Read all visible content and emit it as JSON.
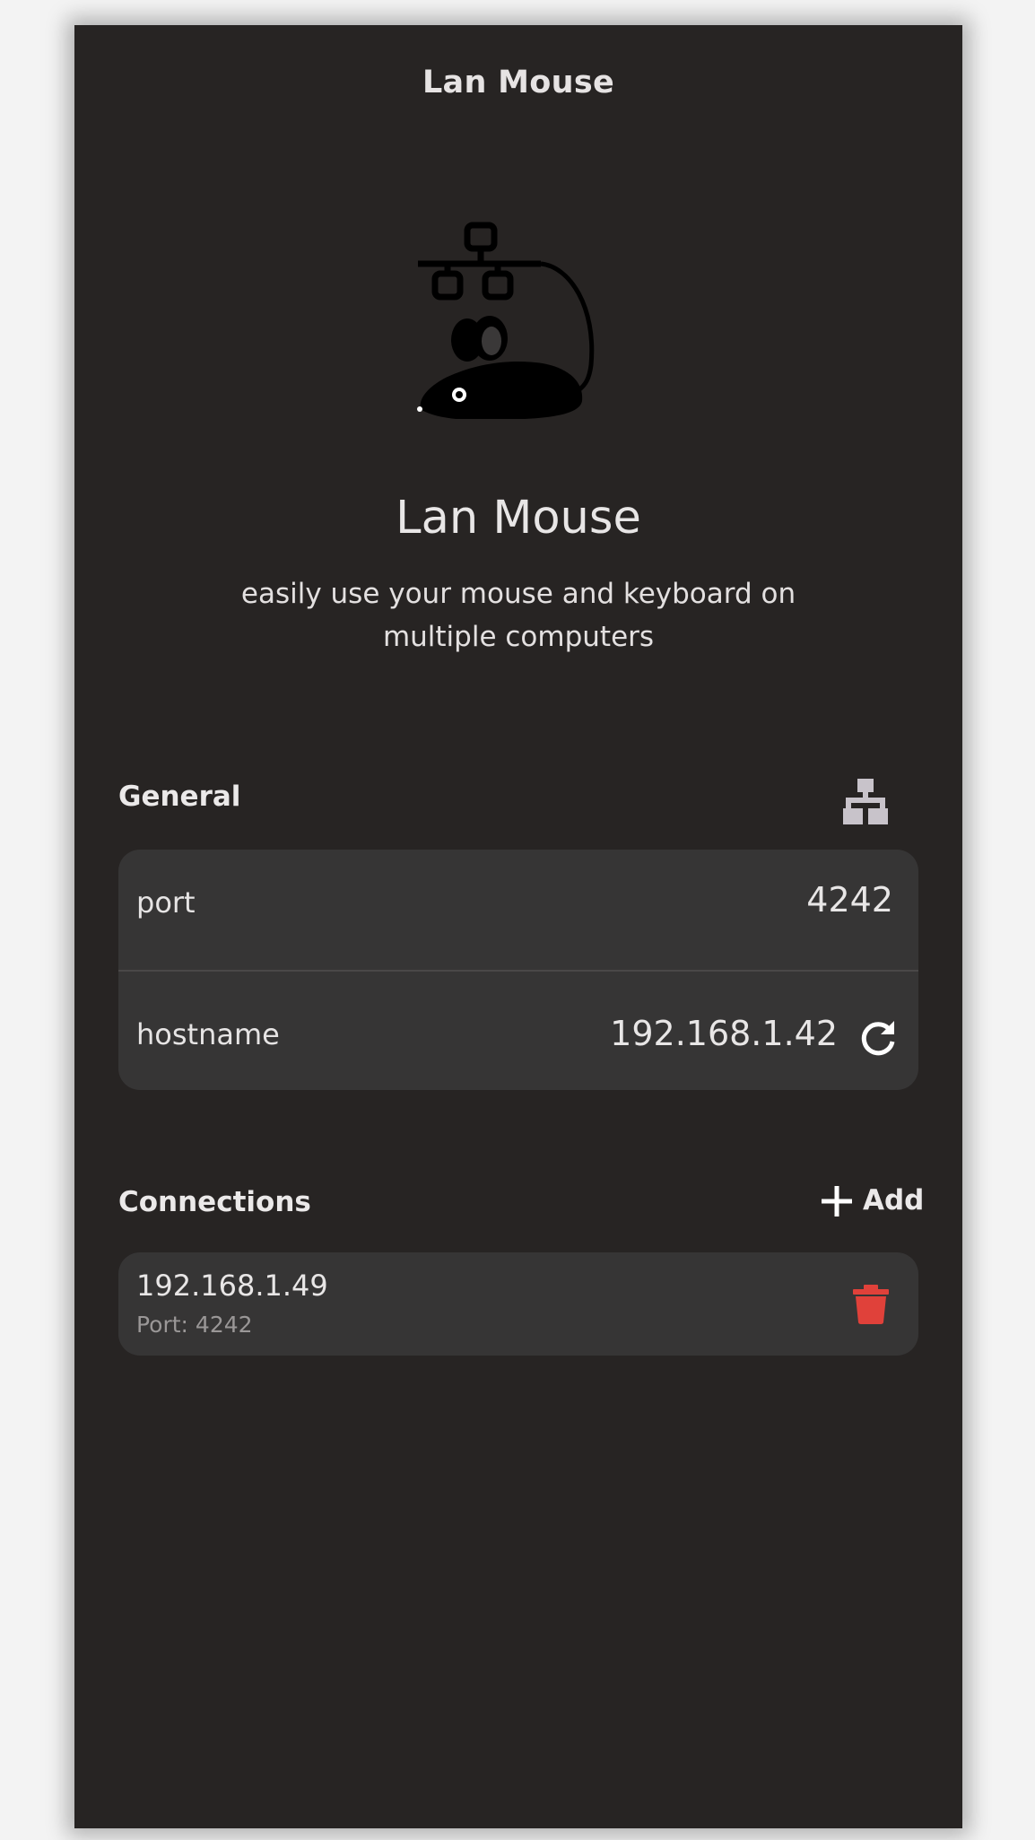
{
  "header": {
    "title": "Lan Mouse"
  },
  "hero": {
    "logo_icon": "lan-mouse-logo",
    "app_name": "Lan Mouse",
    "tagline": "easily use your mouse and keyboard on multiple computers"
  },
  "general": {
    "title": "General",
    "network_icon": "network-icon",
    "port": {
      "label": "port",
      "value": "4242"
    },
    "hostname": {
      "label": "hostname",
      "value": "192.168.1.42",
      "refresh_icon": "refresh-icon"
    }
  },
  "connections": {
    "title": "Connections",
    "add_label": "Add",
    "add_icon": "plus-icon",
    "items": [
      {
        "host": "192.168.1.49",
        "port_text": "Port: 4242",
        "delete_icon": "trash-icon"
      }
    ]
  },
  "colors": {
    "background": "#272423",
    "card": "#363535",
    "text": "#e8e6e6",
    "muted": "#9a9797",
    "danger": "#e0413a",
    "network_icon": "#c8c3ca"
  }
}
